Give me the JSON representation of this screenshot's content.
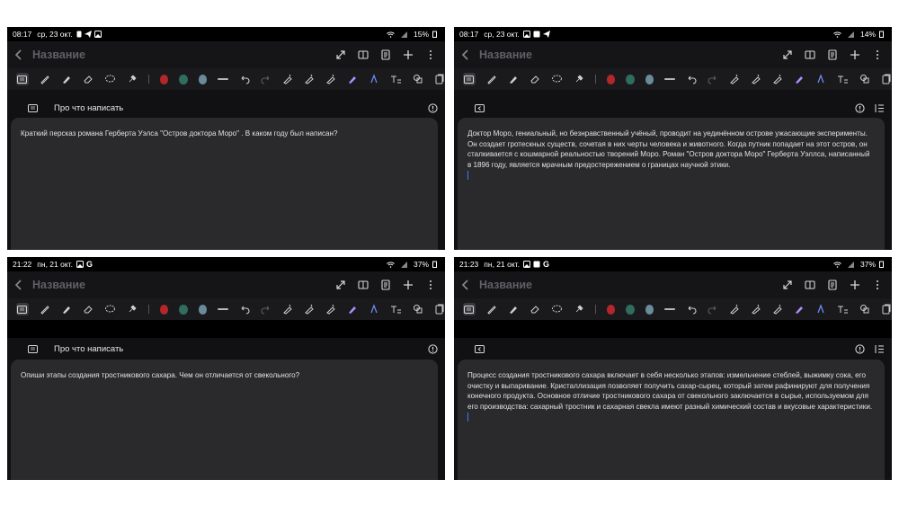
{
  "panels": [
    {
      "status": {
        "time": "08:17",
        "date": "ср, 23 окт.",
        "battery": "15%",
        "icons": [
          "sim-icon",
          "telegram-icon",
          "gallery-icon"
        ]
      },
      "title": "Название",
      "ai_bar": {
        "label": "Про что написать",
        "mode": "prompt"
      },
      "content": "Краткий персказ романа Герберта Уэлса \"Остров доктора Моро\" . В каком году был написан?",
      "has_cursor": false,
      "has_blackbar": false
    },
    {
      "status": {
        "time": "08:17",
        "date": "ср, 23 окт.",
        "battery": "14%",
        "icons": [
          "gallery-icon",
          "photo-icon",
          "telegram-icon"
        ]
      },
      "title": "Название",
      "ai_bar": {
        "label": "",
        "mode": "result"
      },
      "content": "Доктор Моро, гениальный, но безнравственный учёный, проводит на уединённом острове ужасающие эксперименты. Он создает гротескных существ, сочетая в них черты человека и животного.  Когда путник попадает на этот остров, он сталкивается с кошмарной реальностью творений Моро.  Роман \"Остров доктора Моро\" Герберта Уэллса,  написанный в 1896 году,  является мрачным предостережением о границах научной этики.",
      "has_cursor": true,
      "has_blackbar": false
    },
    {
      "status": {
        "time": "21:22",
        "date": "пн, 21 окт.",
        "battery": "37%",
        "icons": [
          "gallery-icon",
          "google-icon"
        ]
      },
      "title": "Название",
      "ai_bar": {
        "label": "Про что написать",
        "mode": "prompt"
      },
      "content": "Опиши этапы создания тростникового сахара. Чем он отличается от свекольного?",
      "has_cursor": false,
      "has_blackbar": true
    },
    {
      "status": {
        "time": "21:23",
        "date": "пн, 21 окт.",
        "battery": "37%",
        "icons": [
          "gallery-icon",
          "photo-icon",
          "google-icon"
        ]
      },
      "title": "Название",
      "ai_bar": {
        "label": "",
        "mode": "result-list"
      },
      "content": "Процесс создания тростникового сахара включает в себя несколько этапов: измельчение стеблей, выжимку сока, его очистку и выпаривание. Кристаллизация позволяет получить сахар-сырец, который затем рафинируют для получения конечного продукта. Основное отличие тростникового сахара от свекольного заключается в сырье, используемом для его производства: сахарный тростник и сахарная свекла имеют разный химический состав и вкусовые характеристики.",
      "has_cursor": true,
      "has_blackbar": true
    }
  ],
  "toolbar": {
    "colors": [
      "#b3262a",
      "#2f6d5e",
      "#6b8b9c"
    ]
  }
}
